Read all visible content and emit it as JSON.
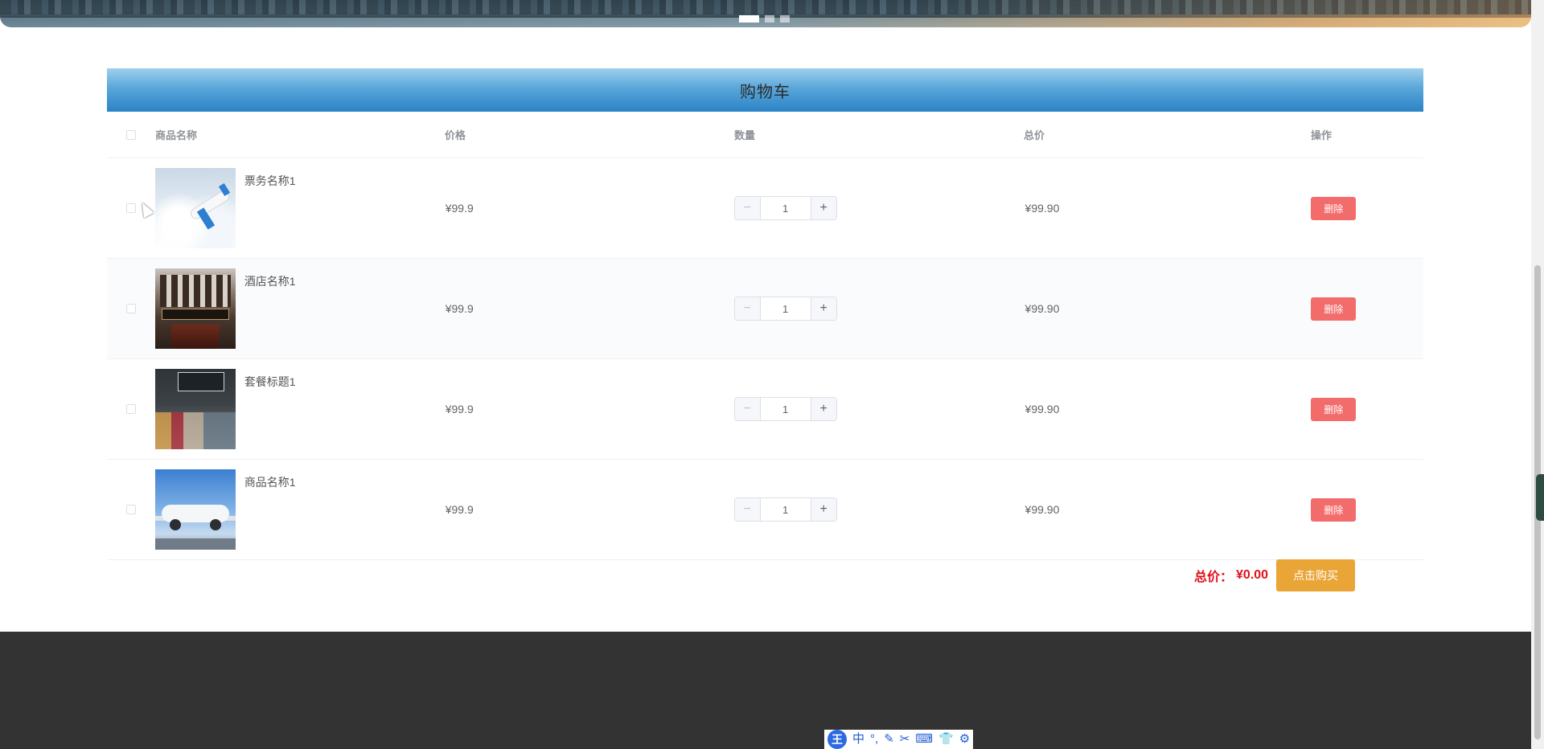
{
  "banner": {
    "dots": [
      "slide-1",
      "slide-2",
      "slide-3"
    ],
    "active_index": 0
  },
  "cart": {
    "title": "购物车",
    "columns": {
      "name": "商品名称",
      "price": "价格",
      "quantity": "数量",
      "total": "总价",
      "operation": "操作"
    },
    "items": [
      {
        "name": "票务名称1",
        "price": "¥99.9",
        "quantity": "1",
        "total": "¥99.90",
        "delete_label": "删除",
        "image_icon": "airplane-in-clouds-image"
      },
      {
        "name": "酒店名称1",
        "price": "¥99.9",
        "quantity": "1",
        "total": "¥99.90",
        "delete_label": "删除",
        "image_icon": "hotel-building-image"
      },
      {
        "name": "套餐标题1",
        "price": "¥99.9",
        "quantity": "1",
        "total": "¥99.90",
        "delete_label": "删除",
        "image_icon": "storefront-image"
      },
      {
        "name": "商品名称1",
        "price": "¥99.9",
        "quantity": "1",
        "total": "¥99.90",
        "delete_label": "删除",
        "image_icon": "airliner-image"
      }
    ],
    "stepper": {
      "minus": "−",
      "plus": "+"
    },
    "summary": {
      "label": "总价：",
      "value": "¥0.00",
      "buy_label": "点击购买"
    }
  },
  "ime_toolbar": {
    "logo": "王",
    "items": [
      "中",
      "°,",
      "✎",
      "✂",
      "⌨",
      "👕",
      "⚙"
    ]
  },
  "colors": {
    "header_gradient_top": "#9fd0ee",
    "header_gradient_bottom": "#2b83c5",
    "delete_button": "#f36c6c",
    "buy_button": "#eaa537",
    "total_price": "#e0101a",
    "footer": "#333333"
  }
}
